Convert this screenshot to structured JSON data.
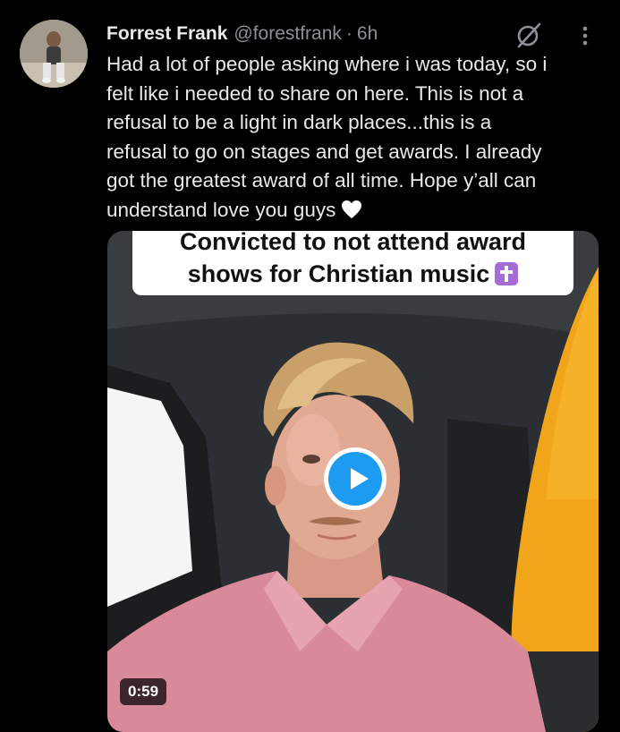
{
  "tweet": {
    "author": {
      "name": "Forrest Frank",
      "handle": "@forestfrank",
      "separator": "·",
      "time": "6h"
    },
    "text_lines": [
      "Had a lot of people asking where i was today, so i",
      "felt like i needed to share on here. This is not a",
      "refusal to be a light in dark places...this is a",
      "refusal to go on stages and get awards. I already",
      "got the greatest award of all time. Hope y’all can",
      "understand love you guys"
    ],
    "icons": {
      "grok": "grok-icon",
      "more": "more-icon",
      "heart": "white-heart-icon",
      "cross": "latin-cross-icon"
    }
  },
  "media": {
    "caption_lines": [
      "Convicted to not attend award",
      "shows for Christian music"
    ],
    "duration": "0:59",
    "colors": {
      "play_button": "#1d9bf0",
      "shirt": "#d98a9a",
      "surfboard": "#f1a51a"
    }
  },
  "colors": {
    "background": "#000000",
    "text": "#e7e9ea",
    "muted": "#8b9096"
  }
}
